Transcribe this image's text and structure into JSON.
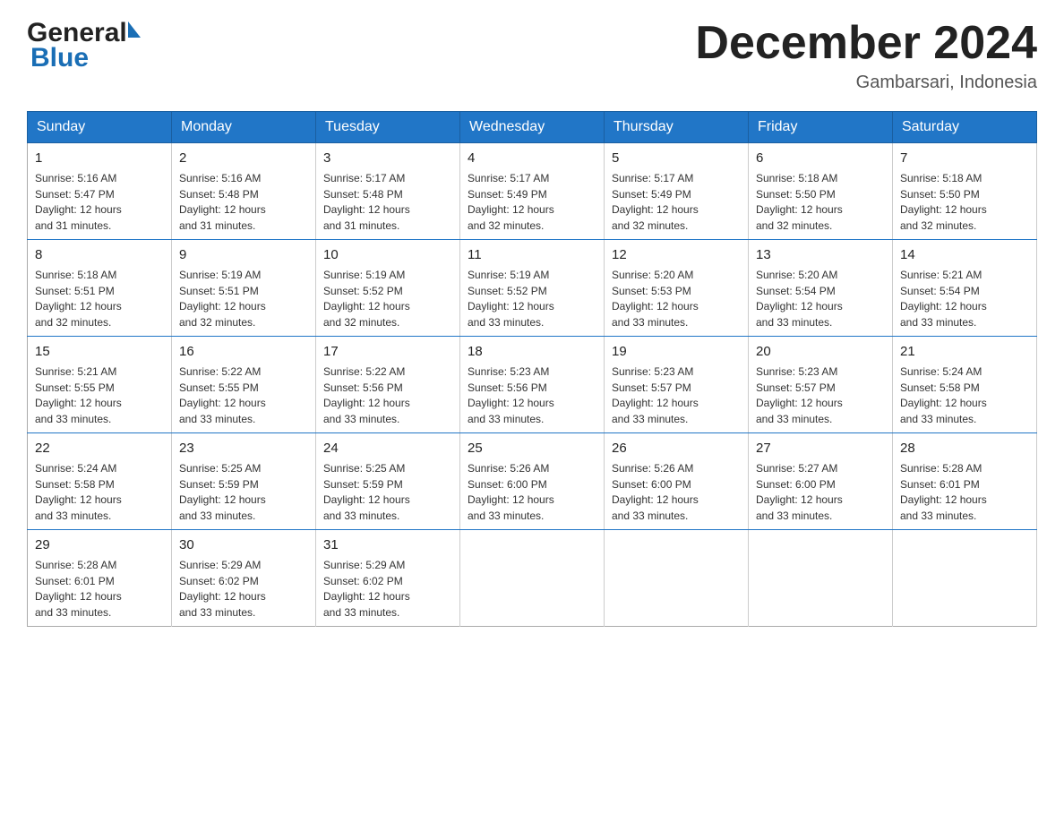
{
  "header": {
    "logo_general": "General",
    "logo_blue": "Blue",
    "month_title": "December 2024",
    "location": "Gambarsari, Indonesia"
  },
  "calendar": {
    "days_of_week": [
      "Sunday",
      "Monday",
      "Tuesday",
      "Wednesday",
      "Thursday",
      "Friday",
      "Saturday"
    ],
    "weeks": [
      [
        {
          "day": "1",
          "sunrise": "5:16 AM",
          "sunset": "5:47 PM",
          "daylight": "12 hours and 31 minutes."
        },
        {
          "day": "2",
          "sunrise": "5:16 AM",
          "sunset": "5:48 PM",
          "daylight": "12 hours and 31 minutes."
        },
        {
          "day": "3",
          "sunrise": "5:17 AM",
          "sunset": "5:48 PM",
          "daylight": "12 hours and 31 minutes."
        },
        {
          "day": "4",
          "sunrise": "5:17 AM",
          "sunset": "5:49 PM",
          "daylight": "12 hours and 32 minutes."
        },
        {
          "day": "5",
          "sunrise": "5:17 AM",
          "sunset": "5:49 PM",
          "daylight": "12 hours and 32 minutes."
        },
        {
          "day": "6",
          "sunrise": "5:18 AM",
          "sunset": "5:50 PM",
          "daylight": "12 hours and 32 minutes."
        },
        {
          "day": "7",
          "sunrise": "5:18 AM",
          "sunset": "5:50 PM",
          "daylight": "12 hours and 32 minutes."
        }
      ],
      [
        {
          "day": "8",
          "sunrise": "5:18 AM",
          "sunset": "5:51 PM",
          "daylight": "12 hours and 32 minutes."
        },
        {
          "day": "9",
          "sunrise": "5:19 AM",
          "sunset": "5:51 PM",
          "daylight": "12 hours and 32 minutes."
        },
        {
          "day": "10",
          "sunrise": "5:19 AM",
          "sunset": "5:52 PM",
          "daylight": "12 hours and 32 minutes."
        },
        {
          "day": "11",
          "sunrise": "5:19 AM",
          "sunset": "5:52 PM",
          "daylight": "12 hours and 33 minutes."
        },
        {
          "day": "12",
          "sunrise": "5:20 AM",
          "sunset": "5:53 PM",
          "daylight": "12 hours and 33 minutes."
        },
        {
          "day": "13",
          "sunrise": "5:20 AM",
          "sunset": "5:54 PM",
          "daylight": "12 hours and 33 minutes."
        },
        {
          "day": "14",
          "sunrise": "5:21 AM",
          "sunset": "5:54 PM",
          "daylight": "12 hours and 33 minutes."
        }
      ],
      [
        {
          "day": "15",
          "sunrise": "5:21 AM",
          "sunset": "5:55 PM",
          "daylight": "12 hours and 33 minutes."
        },
        {
          "day": "16",
          "sunrise": "5:22 AM",
          "sunset": "5:55 PM",
          "daylight": "12 hours and 33 minutes."
        },
        {
          "day": "17",
          "sunrise": "5:22 AM",
          "sunset": "5:56 PM",
          "daylight": "12 hours and 33 minutes."
        },
        {
          "day": "18",
          "sunrise": "5:23 AM",
          "sunset": "5:56 PM",
          "daylight": "12 hours and 33 minutes."
        },
        {
          "day": "19",
          "sunrise": "5:23 AM",
          "sunset": "5:57 PM",
          "daylight": "12 hours and 33 minutes."
        },
        {
          "day": "20",
          "sunrise": "5:23 AM",
          "sunset": "5:57 PM",
          "daylight": "12 hours and 33 minutes."
        },
        {
          "day": "21",
          "sunrise": "5:24 AM",
          "sunset": "5:58 PM",
          "daylight": "12 hours and 33 minutes."
        }
      ],
      [
        {
          "day": "22",
          "sunrise": "5:24 AM",
          "sunset": "5:58 PM",
          "daylight": "12 hours and 33 minutes."
        },
        {
          "day": "23",
          "sunrise": "5:25 AM",
          "sunset": "5:59 PM",
          "daylight": "12 hours and 33 minutes."
        },
        {
          "day": "24",
          "sunrise": "5:25 AM",
          "sunset": "5:59 PM",
          "daylight": "12 hours and 33 minutes."
        },
        {
          "day": "25",
          "sunrise": "5:26 AM",
          "sunset": "6:00 PM",
          "daylight": "12 hours and 33 minutes."
        },
        {
          "day": "26",
          "sunrise": "5:26 AM",
          "sunset": "6:00 PM",
          "daylight": "12 hours and 33 minutes."
        },
        {
          "day": "27",
          "sunrise": "5:27 AM",
          "sunset": "6:00 PM",
          "daylight": "12 hours and 33 minutes."
        },
        {
          "day": "28",
          "sunrise": "5:28 AM",
          "sunset": "6:01 PM",
          "daylight": "12 hours and 33 minutes."
        }
      ],
      [
        {
          "day": "29",
          "sunrise": "5:28 AM",
          "sunset": "6:01 PM",
          "daylight": "12 hours and 33 minutes."
        },
        {
          "day": "30",
          "sunrise": "5:29 AM",
          "sunset": "6:02 PM",
          "daylight": "12 hours and 33 minutes."
        },
        {
          "day": "31",
          "sunrise": "5:29 AM",
          "sunset": "6:02 PM",
          "daylight": "12 hours and 33 minutes."
        },
        null,
        null,
        null,
        null
      ]
    ],
    "sunrise_label": "Sunrise:",
    "sunset_label": "Sunset:",
    "daylight_label": "Daylight:"
  }
}
